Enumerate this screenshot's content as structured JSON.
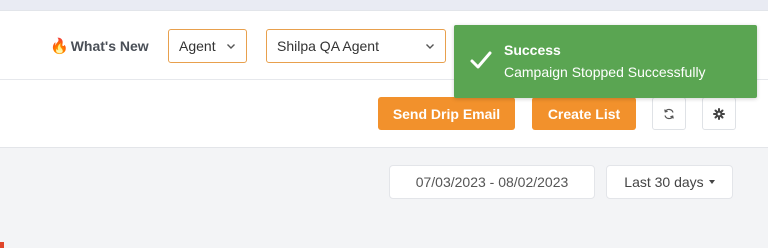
{
  "navbar": {
    "whats_new": "What's New",
    "whats_new_icon": "fire-icon",
    "agent_select": {
      "value": "Agent"
    },
    "agent_name_select": {
      "value": "Shilpa QA Agent"
    }
  },
  "toolbar": {
    "send_drip_email": "Send Drip Email",
    "create_list": "Create List",
    "refresh_icon": "refresh-icon",
    "settings_icon": "gear-icon"
  },
  "filters": {
    "date_range": "07/03/2023 - 08/02/2023",
    "period": "Last 30 days"
  },
  "toast": {
    "title": "Success",
    "message": "Campaign Stopped Successfully",
    "icon": "check-icon"
  },
  "colors": {
    "accent": "#f2912c",
    "success": "#5aa552",
    "select_border": "#e8a04d"
  }
}
